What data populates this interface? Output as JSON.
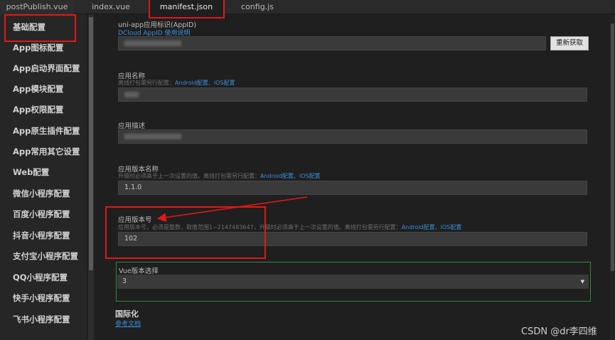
{
  "tabs": [
    "postPublish.vue",
    "index.vue",
    "manifest.json",
    "config.js"
  ],
  "sidebar": {
    "items": [
      "基础配置",
      "App图标配置",
      "App启动界面配置",
      "App模块配置",
      "App权限配置",
      "App原生插件配置",
      "App常用其它设置",
      "Web配置",
      "微信小程序配置",
      "百度小程序配置",
      "抖音小程序配置",
      "支付宝小程序配置",
      "QQ小程序配置",
      "快手小程序配置",
      "飞书小程序配置"
    ]
  },
  "appid": {
    "label": "uni-app应用标识(AppID)",
    "link": "DCloud AppID 使用说明",
    "button": "重新获取"
  },
  "app_name": {
    "label": "应用名称",
    "hint": "离线打包需另行配置：",
    "link": "Android配置、iOS配置"
  },
  "app_desc": {
    "label": "应用描述"
  },
  "version_name": {
    "label": "应用版本名称",
    "hint": "升级时必须高于上一次设置的值。离线打包需另行配置：",
    "link": "Android配置、iOS配置",
    "value": "1.1.0"
  },
  "version_code": {
    "label": "应用版本号",
    "hint": "应用版本号，必须是整数，取值范围1~2147483647，升级时必须高于上一次设置的值。离线打包需另行配置：",
    "link": "Android配置、iOS配置",
    "value": "102"
  },
  "vue_version": {
    "label": "Vue版本选择",
    "value": "3"
  },
  "i18n": {
    "label": "国际化",
    "link": "参考文档"
  },
  "watermark": "CSDN @dr李四维",
  "colors": {
    "highlight": "#e01818",
    "accent_border": "#2c8c3c",
    "link": "#3b8fd9"
  },
  "icons": {
    "select_caret": "caret-down-icon"
  }
}
